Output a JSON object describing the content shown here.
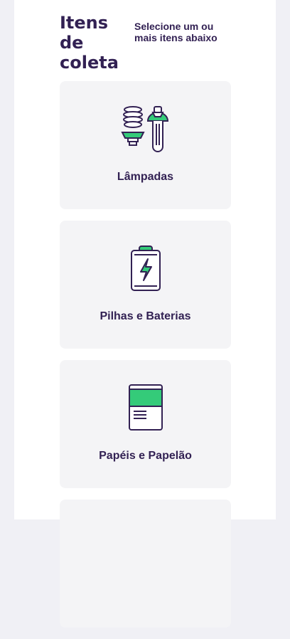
{
  "header": {
    "title": "Itens de coleta",
    "subtitle": "Selecione um ou mais itens abaixo"
  },
  "items": [
    {
      "label": "Lâmpadas",
      "icon": "lamps-icon"
    },
    {
      "label": "Pilhas e Baterias",
      "icon": "battery-icon"
    },
    {
      "label": "Papéis e Papelão",
      "icon": "paper-icon"
    },
    {
      "label": "",
      "icon": ""
    }
  ],
  "colors": {
    "accent": "#34cb79",
    "text": "#322153",
    "card": "#f4f4f6",
    "background": "#f0f0f5"
  }
}
